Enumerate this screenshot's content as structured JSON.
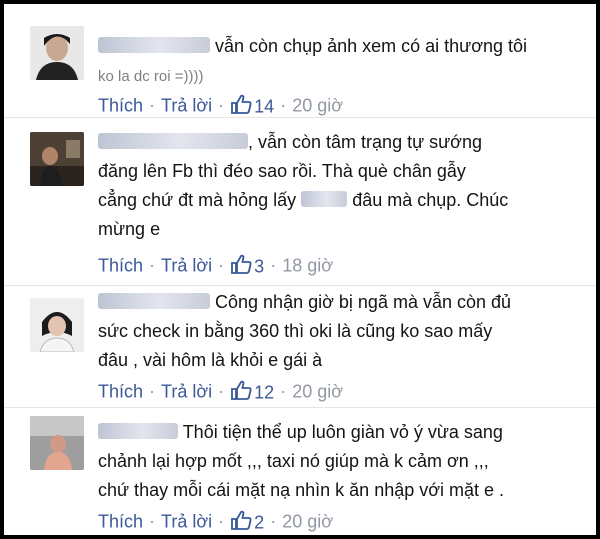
{
  "actions": {
    "like": "Thích",
    "reply": "Trả lời",
    "sep": "·"
  },
  "colors": {
    "link": "#3b5998",
    "muted": "#9197a3",
    "text": "#141414"
  },
  "comments": [
    {
      "author_visible": "",
      "lines": [
        "vẫn còn chụp ảnh xem có ai thương tôi",
        "ko la dc roi =))))"
      ],
      "likes": "14",
      "time": "20 giờ"
    },
    {
      "author_visible": "",
      "lines": [
        ", vẫn còn tâm trạng tự sướng",
        "đăng lên Fb thì đéo sao rồi. Thà què chân gẫy",
        "cẳng chứ đt mà hỏng lấy",
        "đâu mà chụp. Chúc",
        "mừng e"
      ],
      "likes": "3",
      "time": "18 giờ"
    },
    {
      "author_visible": "",
      "lines": [
        "Công nhận giờ bị ngã mà vẫn còn đủ",
        "sức check in bằng 360 thì oki là cũng ko sao mấy",
        "đâu , vài hôm là khỏi e gái à"
      ],
      "likes": "12",
      "time": "20 giờ"
    },
    {
      "author_visible": "",
      "lines": [
        "Thôi tiện thể up luôn giàn vỏ ý vừa sang",
        "chảnh lại hợp mốt ,,, taxi nó giúp mà k cảm ơn ,,,",
        "chứ thay mỗi cái mặt nạ nhìn k ăn nhập với mặt e ."
      ],
      "likes": "2",
      "time": "20 giờ"
    }
  ]
}
